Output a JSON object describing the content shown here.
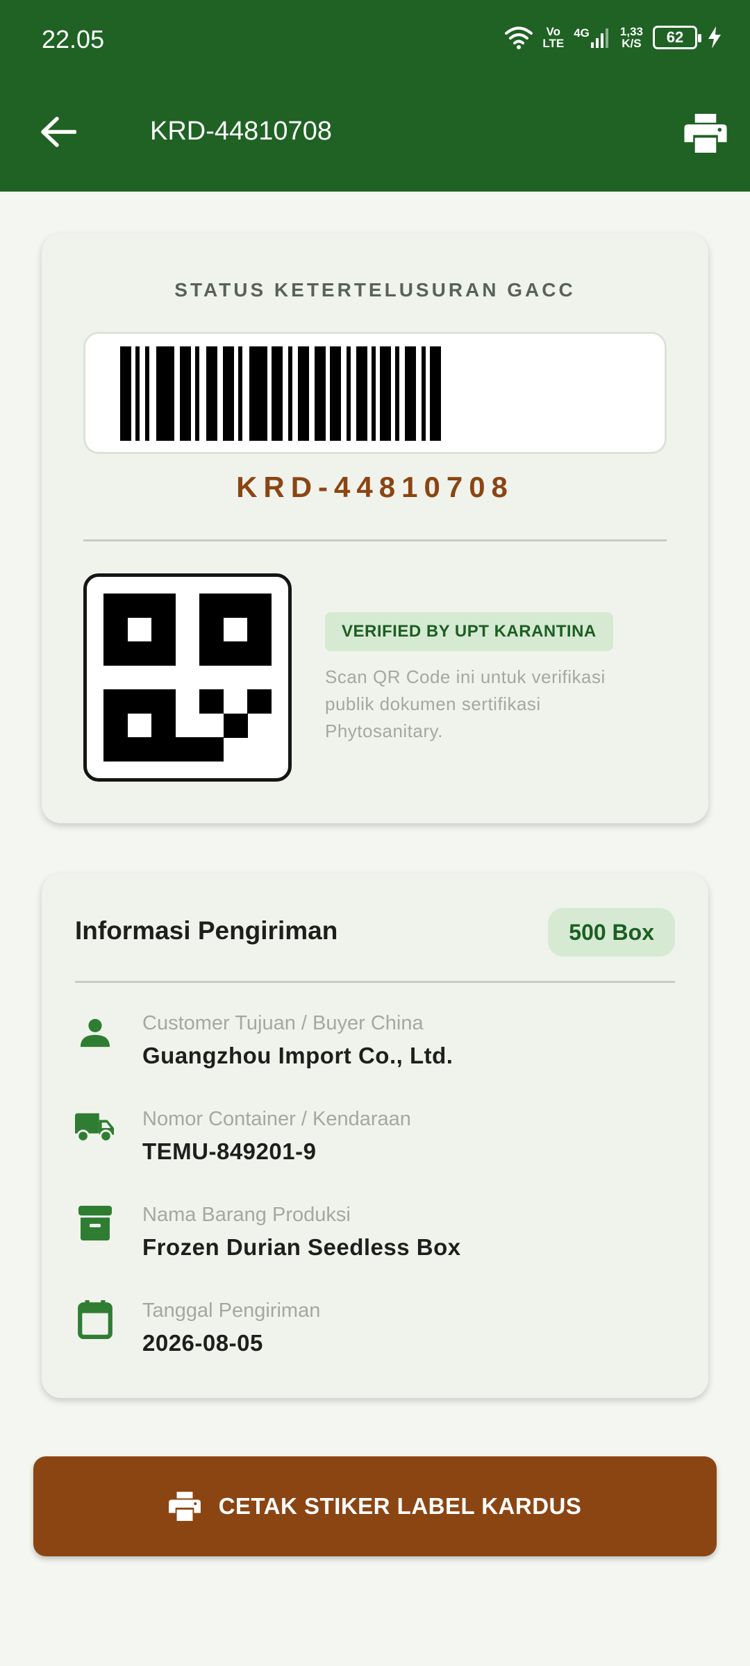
{
  "status_bar": {
    "time": "22.05",
    "volte_top": "Vo",
    "volte_bottom": "LTE",
    "network": "4G",
    "speed_top": "1,33",
    "speed_bottom": "K/S",
    "battery": "62"
  },
  "app_bar": {
    "title": "KRD-44810708",
    "back_icon": "arrow-left-icon",
    "print_icon": "printer-icon"
  },
  "trace_card": {
    "title": "STATUS KETERTELUSURAN GACC",
    "code": "KRD-44810708",
    "badge": "VERIFIED BY UPT KARANTINA",
    "description": "Scan QR Code ini untuk verifikasi publik dokumen sertifikasi Phytosanitary."
  },
  "shipment": {
    "title": "Informasi Pengiriman",
    "quantity": "500 Box",
    "rows": [
      {
        "icon": "person-icon",
        "label": "Customer Tujuan / Buyer China",
        "value": "Guangzhou Import Co., Ltd."
      },
      {
        "icon": "truck-icon",
        "label": "Nomor Container / Kendaraan",
        "value": "TEMU-849201-9"
      },
      {
        "icon": "archive-box-icon",
        "label": "Nama Barang Produksi",
        "value": "Frozen Durian Seedless Box"
      },
      {
        "icon": "calendar-icon",
        "label": "Tanggal Pengiriman",
        "value": "2026-08-05"
      }
    ]
  },
  "action_button": {
    "label": "CETAK STIKER LABEL KARDUS",
    "icon": "printer-icon"
  },
  "colors": {
    "primary_green": "#1f6224",
    "accent_brown": "#8b4513",
    "badge_green_bg": "#d6ead3"
  }
}
